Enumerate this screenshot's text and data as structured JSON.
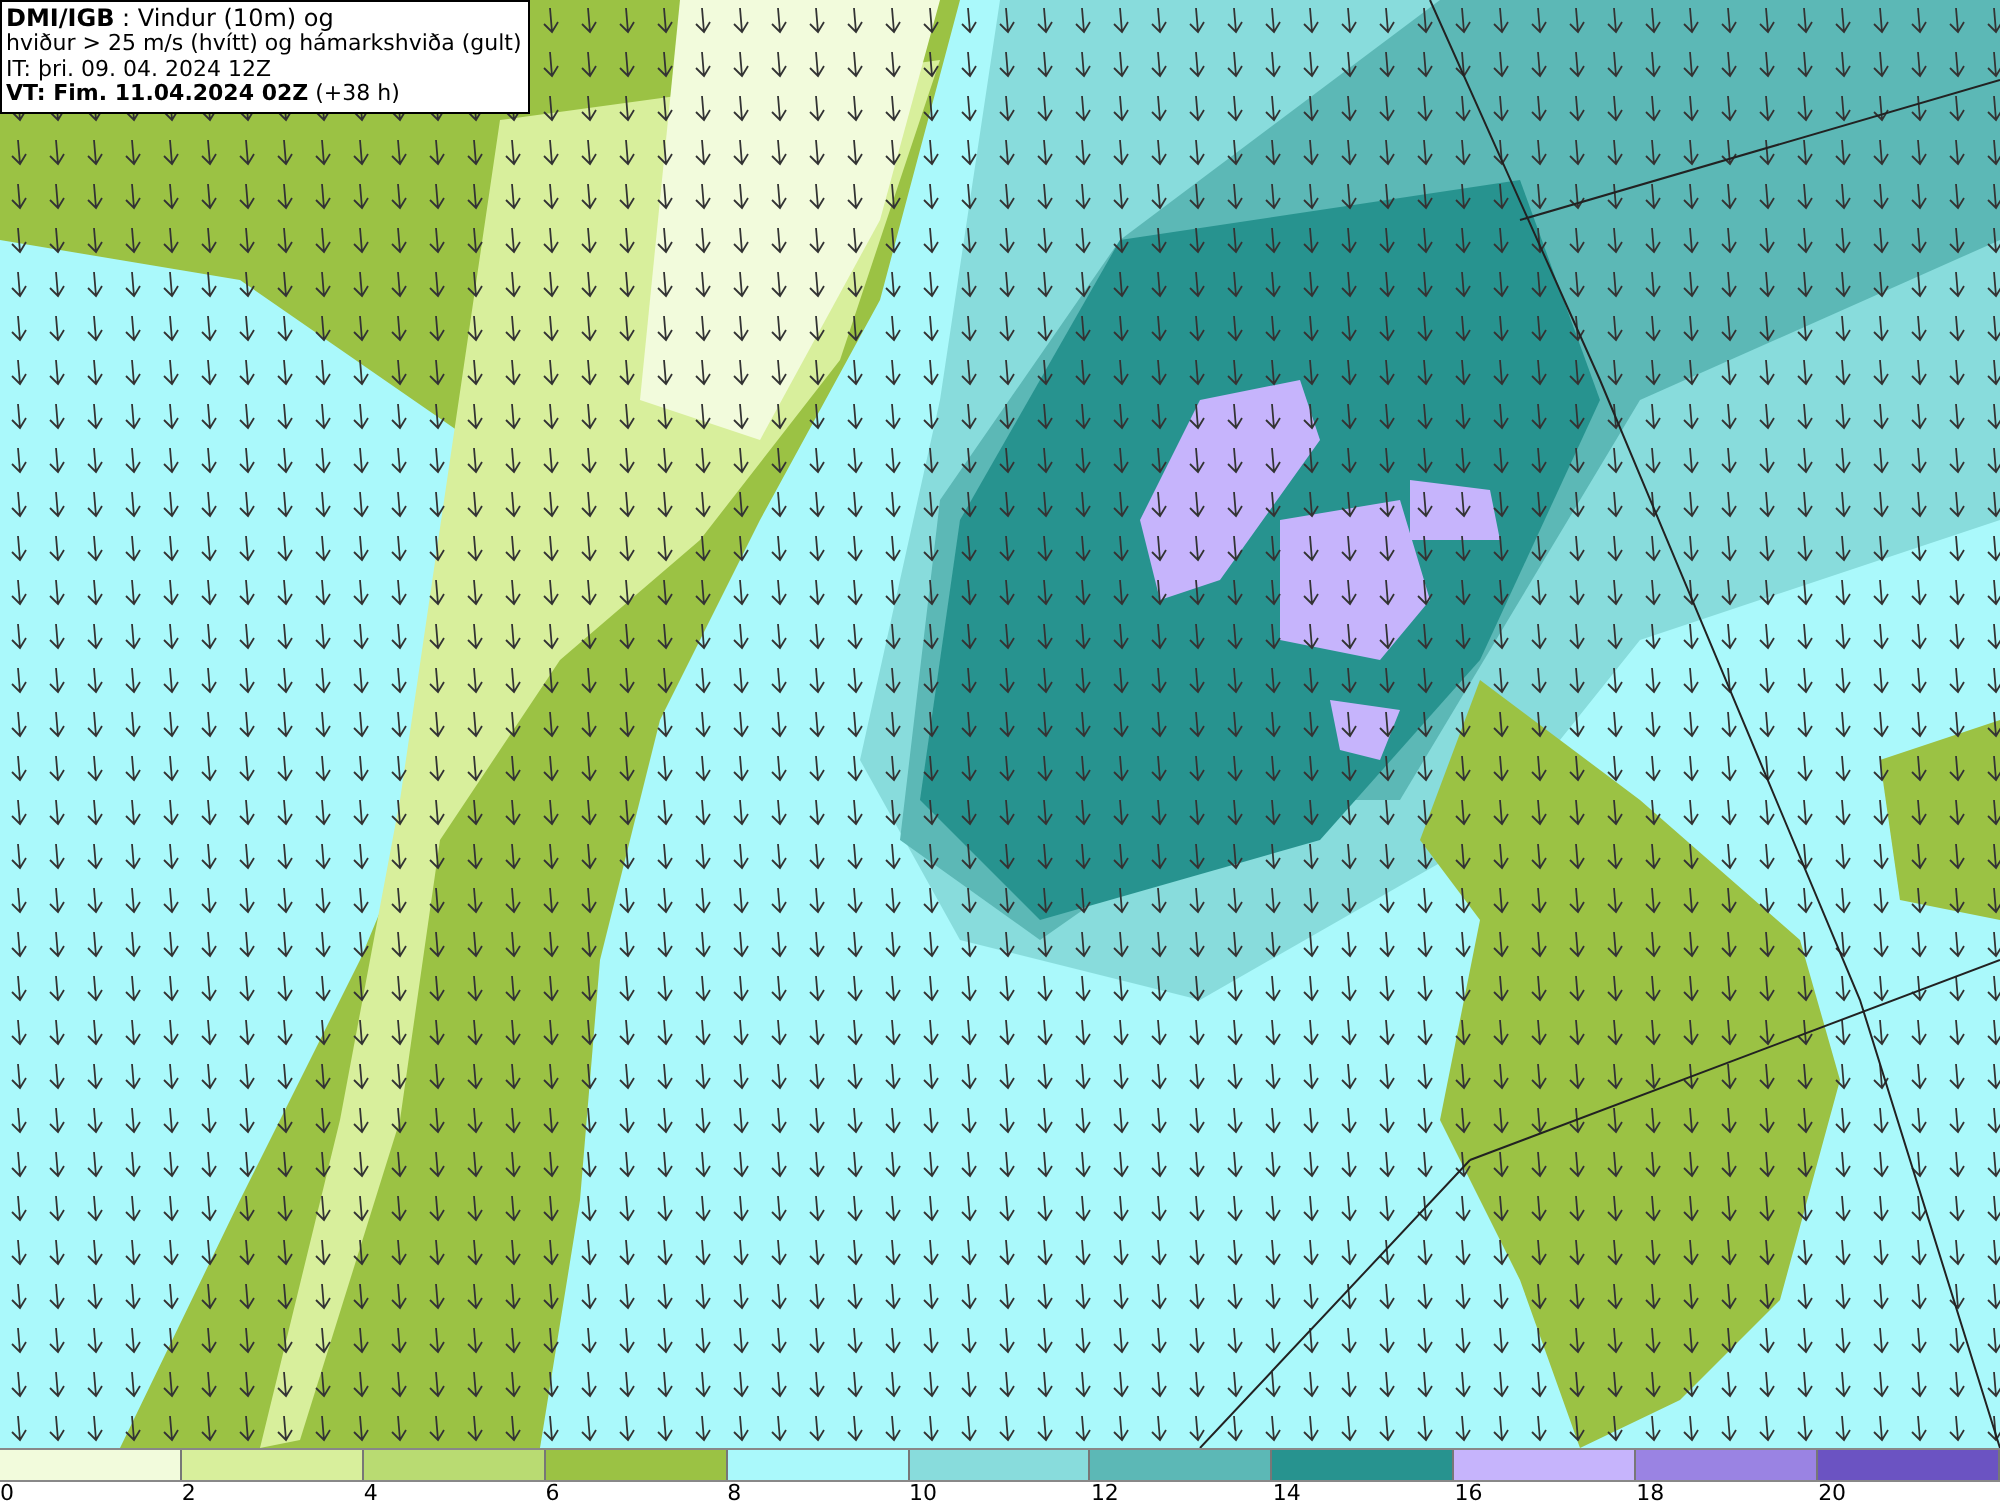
{
  "header": {
    "lines": [
      "**DMI/IGB** : Vindur (10m) og",
      "hviður > 25 m/s (hvítt) og hámarkshviða (gult)",
      "IT: þri. 09. 04. 2024 12Z",
      "**VT: Fim. 11.04.2024 02Z** (+38 h)"
    ]
  },
  "legend": {
    "bins": [
      {
        "color": "#f2fbdc"
      },
      {
        "color": "#d8ef9c"
      },
      {
        "color": "#b9db72"
      },
      {
        "color": "#9bc244"
      },
      {
        "color": "#aaf9fb"
      },
      {
        "color": "#88dcdc"
      },
      {
        "color": "#5cb8b6"
      },
      {
        "color": "#27938f"
      },
      {
        "color": "#c6b4fc"
      },
      {
        "color": "#9a83e3"
      },
      {
        "color": "#6b53c2"
      }
    ],
    "ticks": [
      "0",
      "2",
      "4",
      "6",
      "8",
      "10",
      "12",
      "14",
      "16",
      "18",
      "20"
    ]
  }
}
